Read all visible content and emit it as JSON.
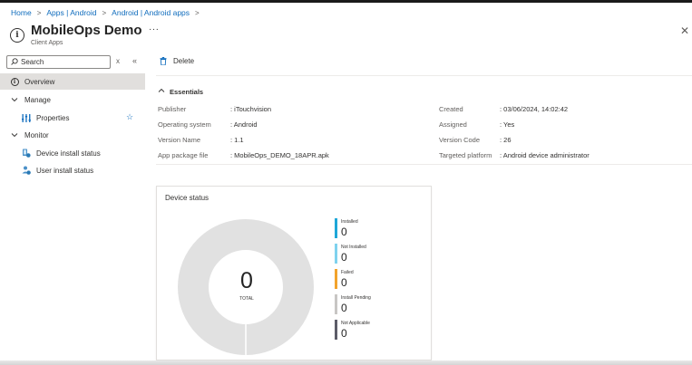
{
  "breadcrumb": [
    "Home",
    "Apps | Android",
    "Android | Android apps"
  ],
  "header": {
    "title": "MobileOps Demo",
    "subtitle": "Client Apps",
    "more": "···",
    "close": "✕"
  },
  "sidebar": {
    "search_placeholder": "Search",
    "clear": "x",
    "collapse": "«",
    "items": {
      "overview": "Overview",
      "manage": "Manage",
      "properties": "Properties",
      "monitor": "Monitor",
      "device_install_status": "Device install status",
      "user_install_status": "User install status"
    }
  },
  "toolbar": {
    "delete_label": "Delete"
  },
  "essentials": {
    "heading": "Essentials",
    "left": [
      {
        "label": "Publisher",
        "value": ": iTouchvision"
      },
      {
        "label": "Operating system",
        "value": ": Android"
      },
      {
        "label": "Version Name",
        "value": ": 1.1"
      },
      {
        "label": "App package file",
        "value": ": MobileOps_DEMO_18APR.apk"
      }
    ],
    "right": [
      {
        "label": "Created",
        "value": ": 03/06/2024, 14:02:42"
      },
      {
        "label": "Assigned",
        "value": ": Yes"
      },
      {
        "label": "Version Code",
        "value": ": 26"
      },
      {
        "label": "Targeted platform",
        "value": ": Android device administrator"
      }
    ]
  },
  "device_status": {
    "title": "Device status",
    "total_value": "0",
    "total_label": "TOTAL",
    "legend": [
      {
        "label": "Installed",
        "value": "0",
        "color": "#1ea7d8"
      },
      {
        "label": "Not Installed",
        "value": "0",
        "color": "#7fd2ee"
      },
      {
        "label": "Failed",
        "value": "0",
        "color": "#f2a32c"
      },
      {
        "label": "Install Pending",
        "value": "0",
        "color": "#c8c6c4"
      },
      {
        "label": "Not Applicable",
        "value": "0",
        "color": "#5c5c68"
      }
    ]
  },
  "colors": {
    "link": "#0f6cbd",
    "selected_nav_bg": "#e1dfdd",
    "donut_empty": "#e1e1e1"
  }
}
